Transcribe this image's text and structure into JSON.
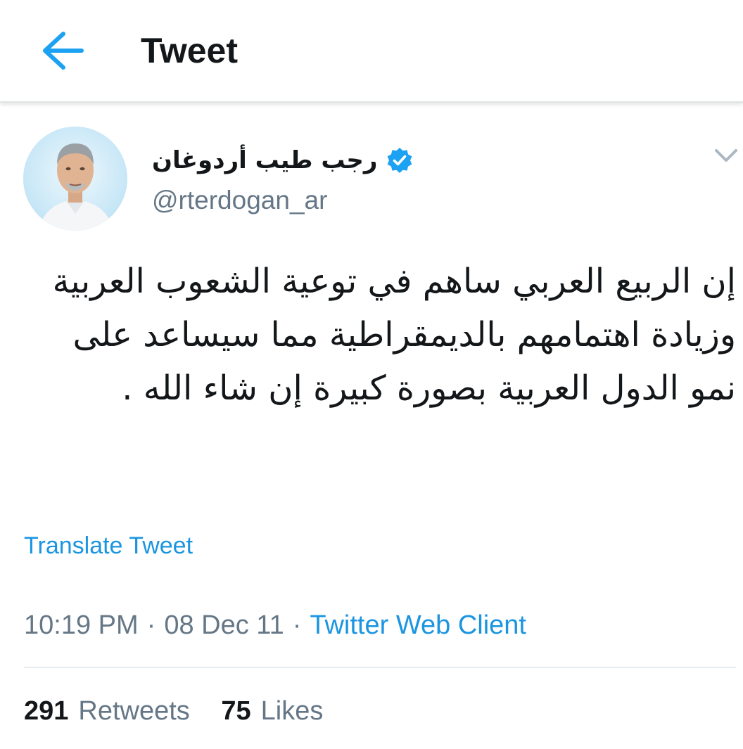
{
  "header": {
    "title": "Tweet",
    "back_icon": "arrow-left-icon",
    "accent": "#1da1f2"
  },
  "tweet": {
    "author": {
      "display_name": "رجب طيب أردوغان",
      "handle": "@rterdogan_ar",
      "verified": true,
      "verified_icon": "verified-badge-icon"
    },
    "menu_icon": "chevron-down-icon",
    "text": "إن الربيع العربي ساهم في توعية الشعوب العربية وزيادة اهتمامهم بالديمقراطية مما سيساعد على نمو الدول العربية بصورة كبيرة إن شاء الله .",
    "translate_label": "Translate Tweet",
    "time": "10:19 PM",
    "date": "08 Dec 11",
    "separator": "·",
    "source": "Twitter Web Client",
    "stats": {
      "retweets_count": "291",
      "retweets_label": "Retweets",
      "likes_count": "75",
      "likes_label": "Likes"
    }
  },
  "colors": {
    "link": "#1b95e0",
    "secondary_text": "#657786",
    "primary_text": "#14171a",
    "verified": "#1da1f2"
  }
}
